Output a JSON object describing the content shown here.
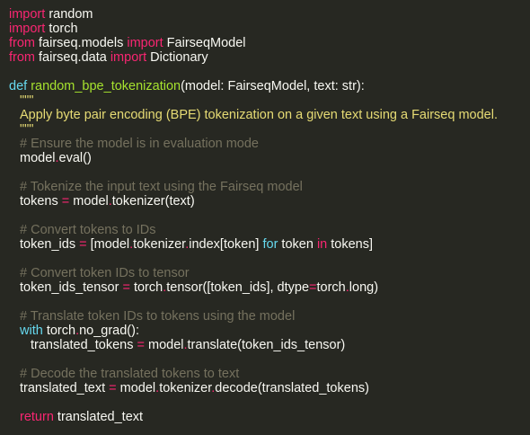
{
  "code": {
    "lines": [
      [
        {
          "t": "import",
          "k": "kw"
        },
        {
          "t": " random",
          "k": "plain"
        }
      ],
      [
        {
          "t": "import",
          "k": "kw"
        },
        {
          "t": " torch",
          "k": "plain"
        }
      ],
      [
        {
          "t": "from",
          "k": "kw"
        },
        {
          "t": " fairseq.models ",
          "k": "plain"
        },
        {
          "t": "import",
          "k": "kw"
        },
        {
          "t": " FairseqModel",
          "k": "plain"
        }
      ],
      [
        {
          "t": "from",
          "k": "kw"
        },
        {
          "t": " fairseq.data ",
          "k": "plain"
        },
        {
          "t": "import",
          "k": "kw"
        },
        {
          "t": " Dictionary",
          "k": "plain"
        }
      ],
      [],
      [
        {
          "t": "def",
          "k": "def"
        },
        {
          "t": " ",
          "k": "plain"
        },
        {
          "t": "random_bpe_tokenization",
          "k": "fn"
        },
        {
          "t": "(model: FairseqModel, text: str):",
          "k": "plain"
        }
      ],
      [
        {
          "t": "\"\"\"",
          "k": "str",
          "indent": 1
        }
      ],
      [
        {
          "t": "Apply byte pair encoding (BPE) tokenization on a given text using a Fairseq model.",
          "k": "str",
          "indent": 1
        }
      ],
      [
        {
          "t": "\"\"\"",
          "k": "str",
          "indent": 1
        }
      ],
      [
        {
          "t": "# Ensure the model is in evaluation mode",
          "k": "com",
          "indent": 1
        }
      ],
      [
        {
          "t": "model",
          "k": "plain",
          "indent": 1
        },
        {
          "t": ".",
          "k": "op"
        },
        {
          "t": "eval()",
          "k": "plain"
        }
      ],
      [],
      [
        {
          "t": "# Tokenize the input text using the Fairseq model",
          "k": "com",
          "indent": 1
        }
      ],
      [
        {
          "t": "tokens ",
          "k": "plain",
          "indent": 1
        },
        {
          "t": "=",
          "k": "op"
        },
        {
          "t": " model",
          "k": "plain"
        },
        {
          "t": ".",
          "k": "op"
        },
        {
          "t": "tokenizer(text)",
          "k": "plain"
        }
      ],
      [],
      [
        {
          "t": "# Convert tokens to IDs",
          "k": "com",
          "indent": 1
        }
      ],
      [
        {
          "t": "token_ids ",
          "k": "plain",
          "indent": 1
        },
        {
          "t": "=",
          "k": "op"
        },
        {
          "t": " [model",
          "k": "plain"
        },
        {
          "t": ".",
          "k": "op"
        },
        {
          "t": "tokenizer",
          "k": "plain"
        },
        {
          "t": ".",
          "k": "op"
        },
        {
          "t": "index[token] ",
          "k": "plain"
        },
        {
          "t": "for",
          "k": "def"
        },
        {
          "t": " token ",
          "k": "plain"
        },
        {
          "t": "in",
          "k": "kw"
        },
        {
          "t": " tokens]",
          "k": "plain"
        }
      ],
      [],
      [
        {
          "t": "# Convert token IDs to tensor",
          "k": "com",
          "indent": 1
        }
      ],
      [
        {
          "t": "token_ids_tensor ",
          "k": "plain",
          "indent": 1
        },
        {
          "t": "=",
          "k": "op"
        },
        {
          "t": " torch",
          "k": "plain"
        },
        {
          "t": ".",
          "k": "op"
        },
        {
          "t": "tensor([token_ids], dtype",
          "k": "plain"
        },
        {
          "t": "=",
          "k": "op"
        },
        {
          "t": "torch",
          "k": "plain"
        },
        {
          "t": ".",
          "k": "op"
        },
        {
          "t": "long)",
          "k": "plain"
        }
      ],
      [],
      [
        {
          "t": "# Translate token IDs to tokens using the model",
          "k": "com",
          "indent": 1
        }
      ],
      [
        {
          "t": "with",
          "k": "def",
          "indent": 1
        },
        {
          "t": " torch",
          "k": "plain"
        },
        {
          "t": ".",
          "k": "op"
        },
        {
          "t": "no_grad():",
          "k": "plain"
        }
      ],
      [
        {
          "t": "translated_tokens ",
          "k": "plain",
          "indent": 2
        },
        {
          "t": "=",
          "k": "op"
        },
        {
          "t": " model",
          "k": "plain"
        },
        {
          "t": ".",
          "k": "op"
        },
        {
          "t": "translate(token_ids_tensor)",
          "k": "plain"
        }
      ],
      [],
      [
        {
          "t": "# Decode the translated tokens to text",
          "k": "com",
          "indent": 1
        }
      ],
      [
        {
          "t": "translated_text ",
          "k": "plain",
          "indent": 1
        },
        {
          "t": "=",
          "k": "op"
        },
        {
          "t": " model",
          "k": "plain"
        },
        {
          "t": ".",
          "k": "op"
        },
        {
          "t": "tokenizer",
          "k": "plain"
        },
        {
          "t": ".",
          "k": "op"
        },
        {
          "t": "decode(translated_tokens)",
          "k": "plain"
        }
      ],
      [],
      [
        {
          "t": "return",
          "k": "kw",
          "indent": 1
        },
        {
          "t": " translated_text",
          "k": "plain"
        }
      ]
    ]
  },
  "theme": {
    "background": "#272822",
    "keyword": "#f92672",
    "storage": "#66d9ef",
    "function": "#a6e22e",
    "string": "#e6db74",
    "comment": "#75715e",
    "text": "#f8f8f2"
  }
}
